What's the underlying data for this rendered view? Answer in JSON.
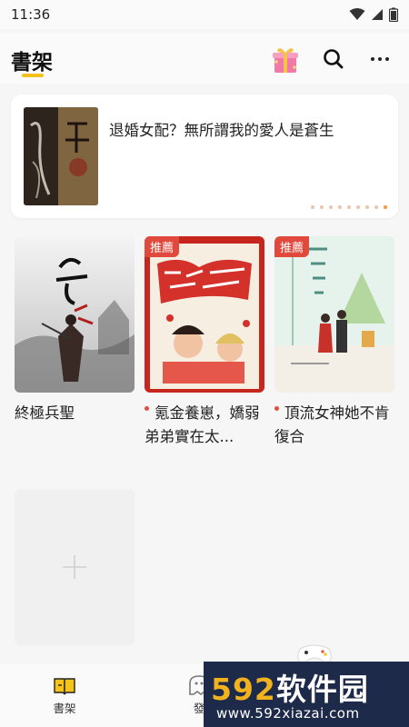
{
  "status_bar": {
    "time": "11:36"
  },
  "header": {
    "title": "書架"
  },
  "banner": {
    "title": "退婚女配？無所謂我的愛人是蒼生",
    "page_count": 9,
    "active_index": 8
  },
  "books": [
    {
      "title": "終極兵聖",
      "recommended": false,
      "badge": ""
    },
    {
      "title": "氪金養崽，嬌弱弟弟實在太...",
      "recommended": true,
      "badge": "推薦"
    },
    {
      "title": "頂流女神她不肯復合",
      "recommended": true,
      "badge": "推薦"
    }
  ],
  "bottom_nav": {
    "items": [
      {
        "label": "書架",
        "icon": "book-icon",
        "active": true
      },
      {
        "label": "發",
        "icon": "ghost-icon",
        "active": false
      }
    ]
  },
  "watermark": {
    "brand_num": "592",
    "brand_cn": "软件园",
    "url": "www.592xiazai.com"
  },
  "colors": {
    "accent": "#f2c21b",
    "badge": "#e0493b",
    "dot_active": "#f29a3c"
  }
}
